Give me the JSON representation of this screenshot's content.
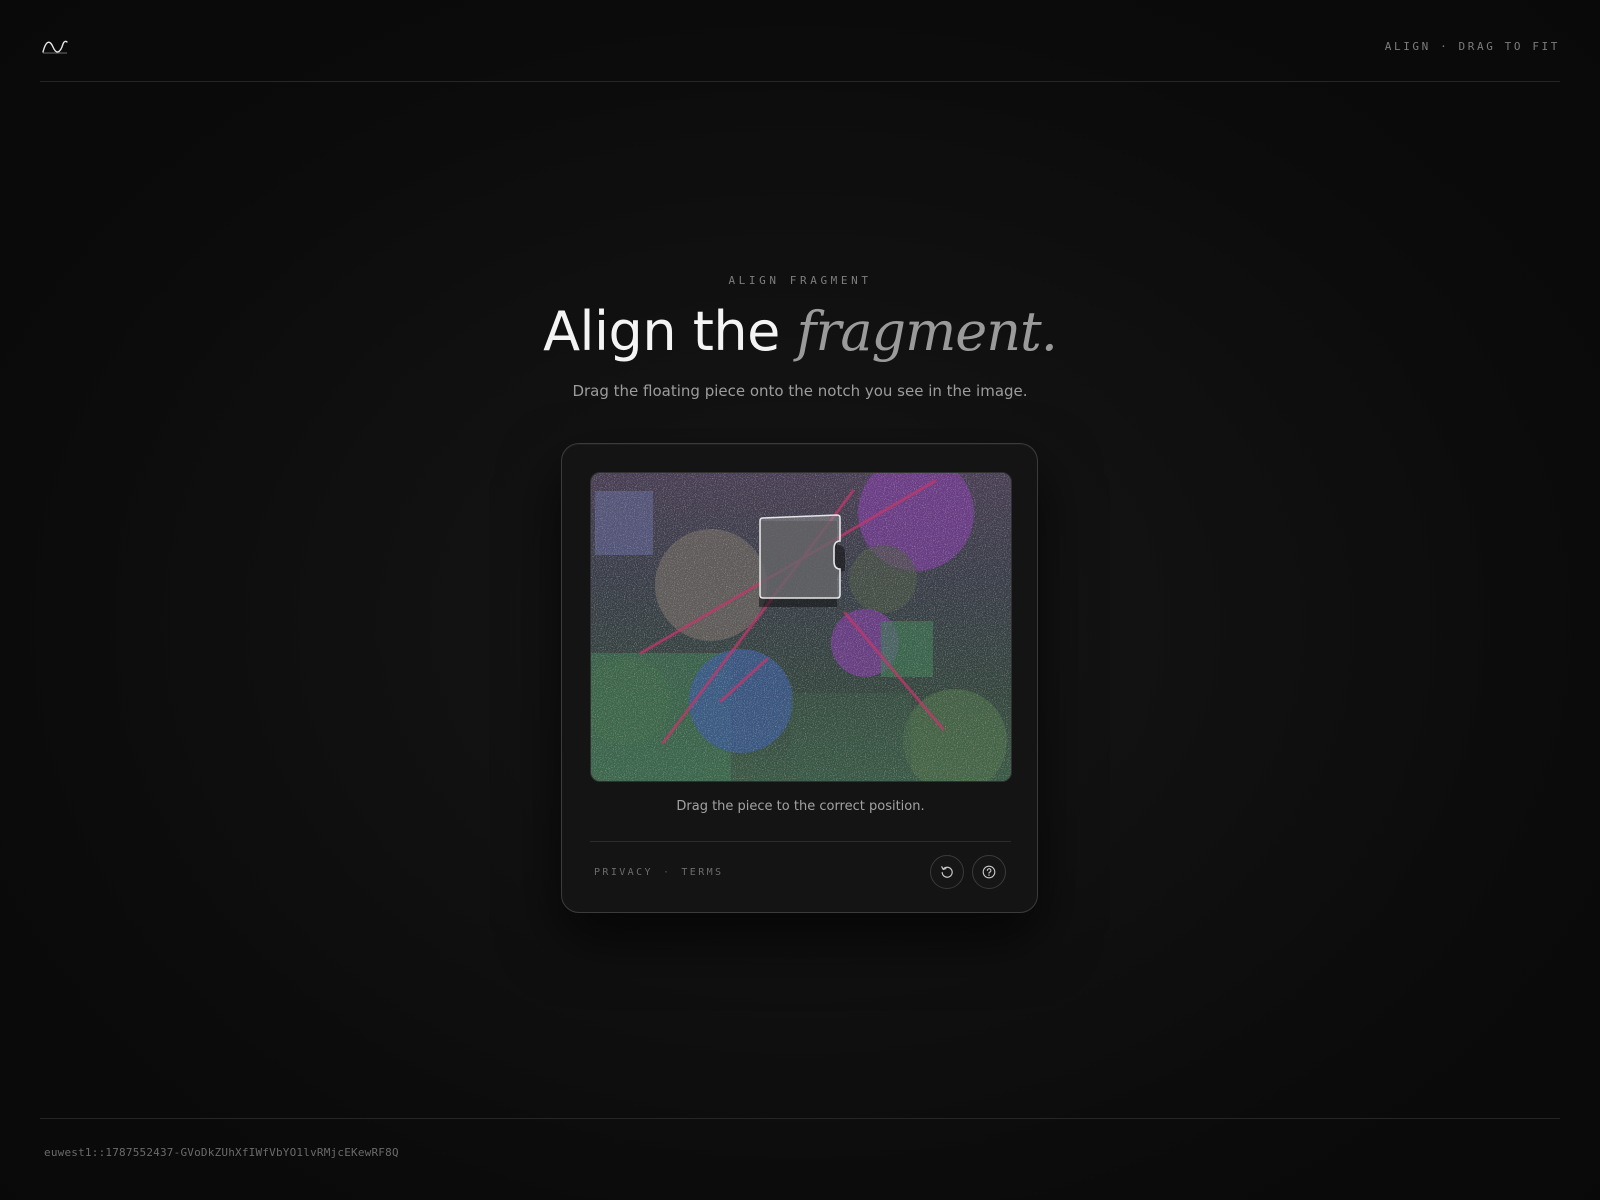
{
  "header": {
    "logo_icon": "wave-logo",
    "mode_label": "ALIGN · DRAG TO FIT"
  },
  "hero": {
    "eyebrow": "ALIGN FRAGMENT",
    "title_plain": "Align the",
    "title_emphasis": "fragment.",
    "subtitle": "Drag the floating piece onto the notch you see in the image."
  },
  "captcha": {
    "instruction": "Drag the piece to the correct position.",
    "privacy_label": "PRIVACY",
    "separator": "·",
    "terms_label": "TERMS",
    "refresh_icon": "refresh-icon",
    "help_icon": "help-icon"
  },
  "footer": {
    "session_id": "euwest1::1787552437-GVoDkZUhXfIWfVbYO1lvRMjcEKewRF8Q"
  },
  "colors": {
    "background": "#0c0c0c",
    "card": "#141414",
    "accent_line": "#c2386a"
  }
}
